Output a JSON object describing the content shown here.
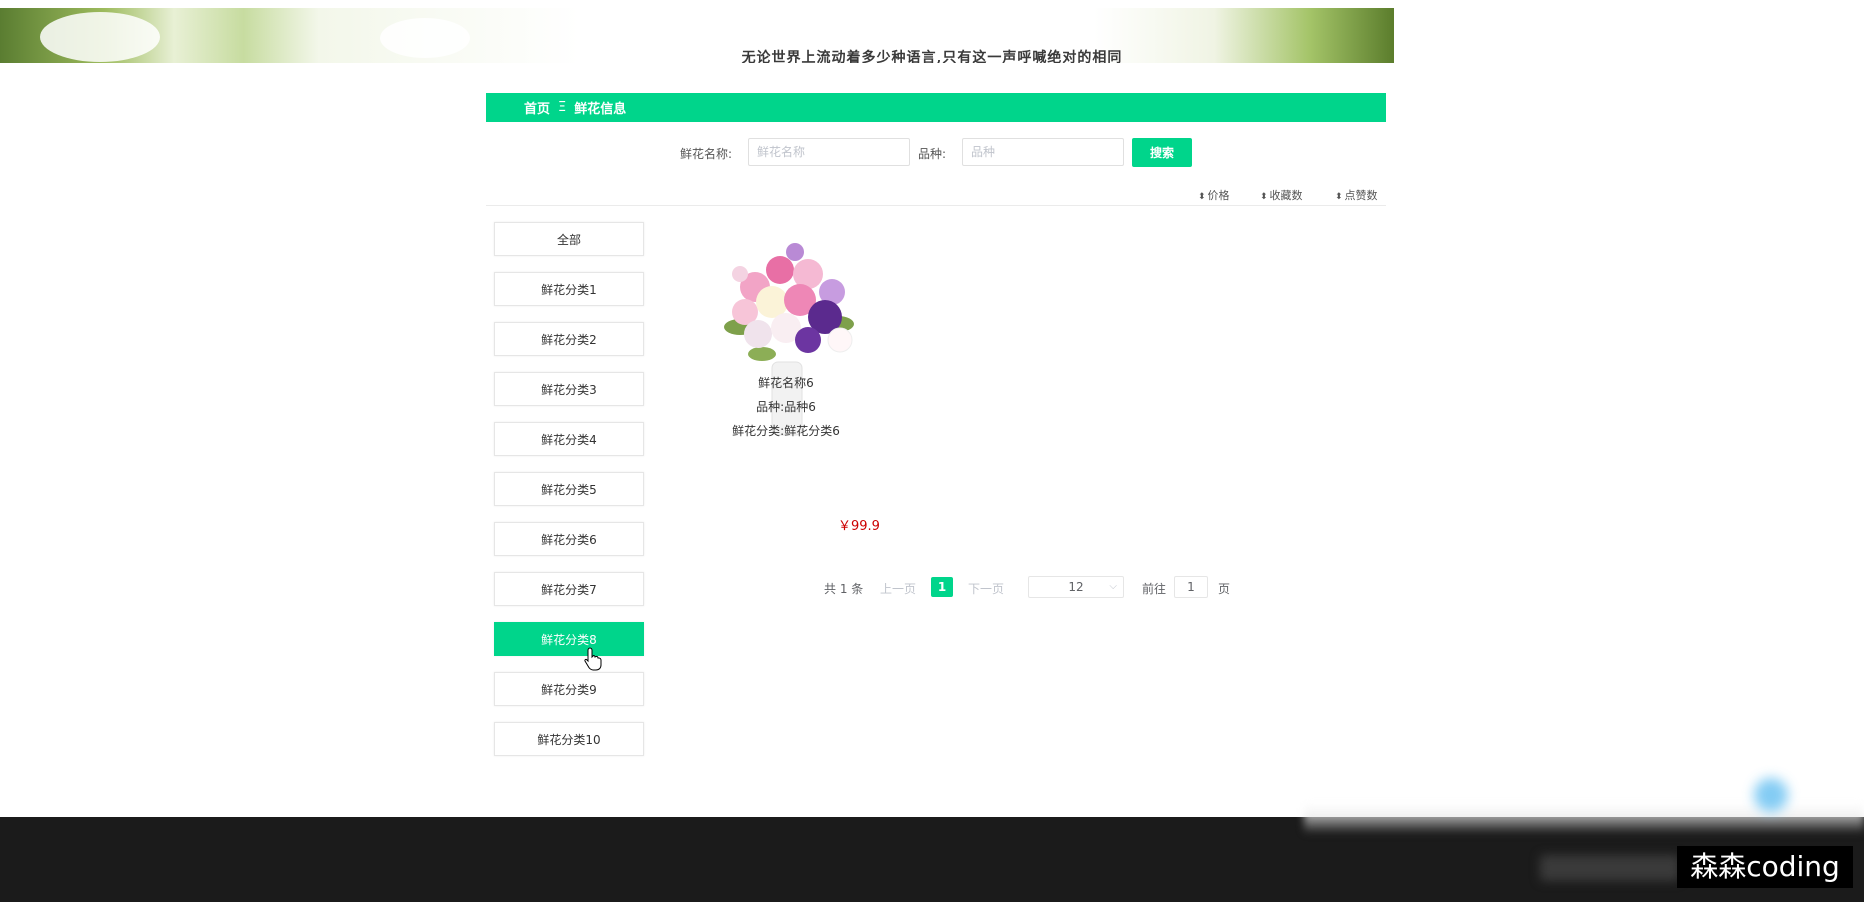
{
  "banner": {
    "slogan": "无论世界上流动着多少种语言,只有这一声呼喊绝对的相同"
  },
  "breadcrumb": {
    "home": "首页",
    "separator": "Ξ",
    "current": "鲜花信息"
  },
  "search": {
    "name_label": "鲜花名称:",
    "name_placeholder": "鲜花名称",
    "variety_label": "品种:",
    "variety_placeholder": "品种",
    "button_label": "搜索"
  },
  "sort": {
    "items": [
      {
        "icon": "sort-icon",
        "label": "价格"
      },
      {
        "icon": "sort-icon",
        "label": "收藏数"
      },
      {
        "icon": "sort-icon",
        "label": "点赞数"
      }
    ]
  },
  "categories": {
    "active_index": 8,
    "items": [
      "全部",
      "鲜花分类1",
      "鲜花分类2",
      "鲜花分类3",
      "鲜花分类4",
      "鲜花分类5",
      "鲜花分类6",
      "鲜花分类7",
      "鲜花分类8",
      "鲜花分类9",
      "鲜花分类10"
    ]
  },
  "products": [
    {
      "name": "鲜花名称6",
      "variety": "品种:品种6",
      "category": "鲜花分类:鲜花分类6",
      "price": "￥99.9"
    }
  ],
  "pagination": {
    "total": "共 1 条",
    "prev": "上一页",
    "current_page": "1",
    "next": "下一页",
    "page_size": "12",
    "goto_label": "前往",
    "goto_value": "1",
    "page_unit": "页"
  },
  "watermark": "森森coding",
  "colors": {
    "accent": "#00d58b",
    "price": "#cc0000",
    "footer": "#1b1b1b"
  }
}
